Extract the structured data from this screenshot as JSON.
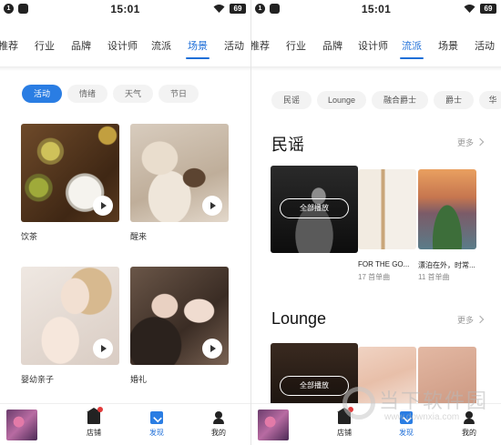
{
  "status_bar": {
    "time": "15:01",
    "battery": "69"
  },
  "left": {
    "nav": {
      "items": [
        "推荐",
        "行业",
        "品牌",
        "设计师",
        "流派",
        "场景",
        "活动"
      ],
      "active": "场景"
    },
    "chips": [
      "活动",
      "情绪",
      "天气",
      "节日"
    ],
    "active_chip": "活动",
    "cards": [
      {
        "caption": "饮茶",
        "image": "tea-photo"
      },
      {
        "caption": "醒来",
        "image": "waking-up-photo"
      },
      {
        "caption": "婴幼亲子",
        "image": "mother-baby-photo"
      },
      {
        "caption": "婚礼",
        "image": "wedding-photo"
      }
    ]
  },
  "right": {
    "nav": {
      "items": [
        "推荐",
        "行业",
        "品牌",
        "设计师",
        "流派",
        "场景",
        "活动"
      ],
      "active": "流派"
    },
    "tags": [
      "民谣",
      "Lounge",
      "融合爵士",
      "爵士",
      "华"
    ],
    "sections": [
      {
        "title": "民谣",
        "more": "更多",
        "play_all": "全部播放",
        "albums": [
          {
            "title": "FOR THE GO...",
            "count": "17 首单曲"
          },
          {
            "title": "漂泊在外，时常...",
            "count": "11 首单曲"
          }
        ]
      },
      {
        "title": "Lounge",
        "more": "更多",
        "play_all": "全部播放"
      }
    ]
  },
  "tabbar": {
    "tabs": [
      {
        "label": "店铺",
        "icon": "store-icon"
      },
      {
        "label": "发现",
        "icon": "discover-icon"
      },
      {
        "label": "我的",
        "icon": "profile-icon"
      }
    ],
    "active": "发现"
  },
  "watermark": {
    "text": "当下软件园",
    "url": "www.downxia.com"
  },
  "colors": {
    "accent": "#1f6fd8",
    "chip_active": "#2a7de3",
    "badge": "#e23b3b"
  }
}
